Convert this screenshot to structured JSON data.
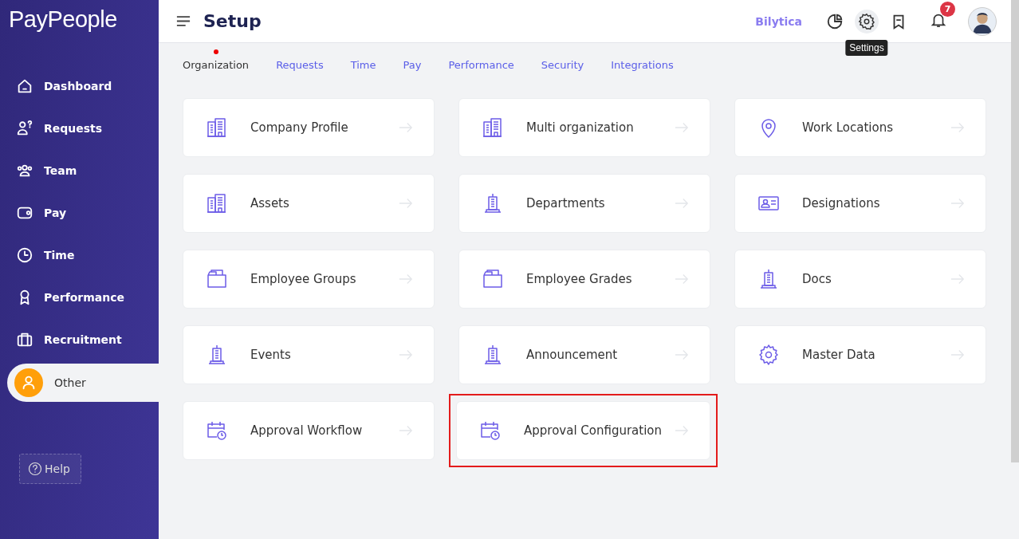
{
  "sidebar": {
    "logo": "PayPeople",
    "items": [
      {
        "label": "Dashboard",
        "kind": "home",
        "selected": false
      },
      {
        "label": "Requests",
        "kind": "request",
        "selected": false
      },
      {
        "label": "Team",
        "kind": "team",
        "selected": false
      },
      {
        "label": "Pay",
        "kind": "wallet",
        "selected": false
      },
      {
        "label": "Time",
        "kind": "clock",
        "selected": false
      },
      {
        "label": "Performance",
        "kind": "award",
        "selected": false
      },
      {
        "label": "Recruitment",
        "kind": "briefcase",
        "selected": false
      },
      {
        "label": "Other",
        "kind": "user",
        "selected": true
      }
    ],
    "help": "Help"
  },
  "header": {
    "title": "Setup",
    "brand_link": "Bilytica",
    "notification_count": "7",
    "tooltip": "Settings"
  },
  "tabs": [
    {
      "label": "Organization",
      "selected": true
    },
    {
      "label": "Requests",
      "selected": false
    },
    {
      "label": "Time",
      "selected": false
    },
    {
      "label": "Pay",
      "selected": false
    },
    {
      "label": "Performance",
      "selected": false
    },
    {
      "label": "Security",
      "selected": false
    },
    {
      "label": "Integrations",
      "selected": false
    }
  ],
  "cards": [
    {
      "label": "Company Profile",
      "kind": "buildings",
      "highlighted": false
    },
    {
      "label": "Multi organization",
      "kind": "buildings",
      "highlighted": false
    },
    {
      "label": "Work Locations",
      "kind": "pin",
      "highlighted": false
    },
    {
      "label": "Assets",
      "kind": "buildings",
      "highlighted": false
    },
    {
      "label": "Departments",
      "kind": "tower",
      "highlighted": false
    },
    {
      "label": "Designations",
      "kind": "idcard",
      "highlighted": false
    },
    {
      "label": "Employee Groups",
      "kind": "folder",
      "highlighted": false
    },
    {
      "label": "Employee Grades",
      "kind": "folder",
      "highlighted": false
    },
    {
      "label": "Docs",
      "kind": "tower",
      "highlighted": false
    },
    {
      "label": "Events",
      "kind": "tower",
      "highlighted": false
    },
    {
      "label": "Announcement",
      "kind": "tower",
      "highlighted": false
    },
    {
      "label": "Master Data",
      "kind": "gear",
      "highlighted": false
    },
    {
      "label": "Approval Workflow",
      "kind": "calendar",
      "highlighted": false
    },
    {
      "label": "Approval Configuration",
      "kind": "calendar",
      "highlighted": true
    }
  ]
}
